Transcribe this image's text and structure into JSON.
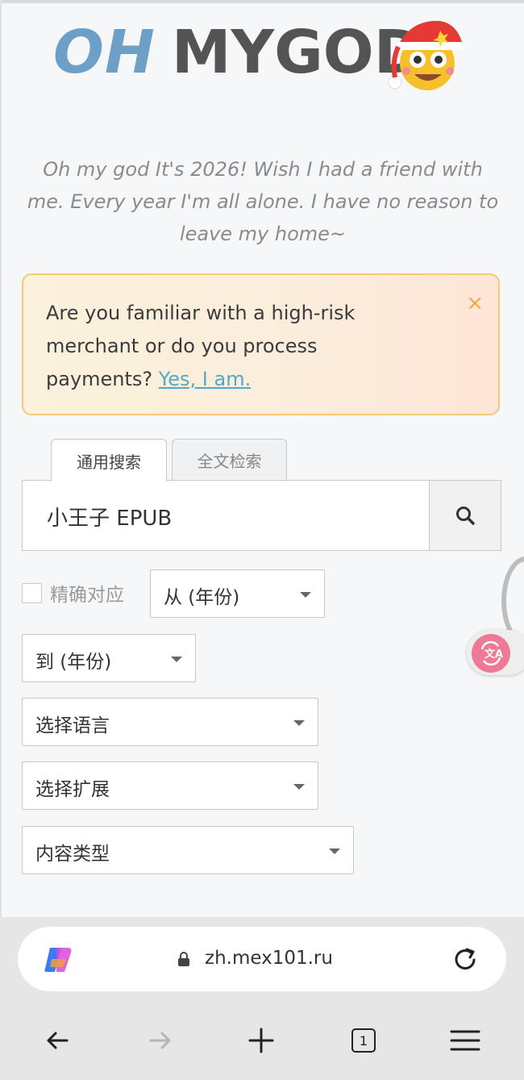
{
  "logo": {
    "part1": "OH",
    "part2": "MYGOD"
  },
  "tagline": "Oh my god It's 2026! Wish I had a friend with me. Every year I'm all alone. I have no reason to leave my home~",
  "alert": {
    "text": "Are you familiar with a high-risk merchant or do you process payments?",
    "link": "Yes, I am.",
    "close": "×"
  },
  "tabs": [
    {
      "label": "通用搜索",
      "active": true
    },
    {
      "label": "全文检索",
      "active": false
    }
  ],
  "search": {
    "value": "小王子 EPUB"
  },
  "filters": {
    "exact_match_label": "精确对应",
    "year_from": "从 (年份)",
    "year_to": "到 (年份)",
    "language": "选择语言",
    "extension": "选择扩展",
    "content_type": "内容类型"
  },
  "browser": {
    "url": "zh.mex101.ru",
    "tab_count": "1"
  },
  "colors": {
    "logo_oh": "#6e9fc6",
    "logo_god": "#545454",
    "alert_border": "#f4c97a",
    "link": "#56a6c8",
    "translate_accent": "#ee7a96"
  },
  "icons": [
    "emoji-santa-face-icon",
    "close-icon",
    "search-icon",
    "translate-icon",
    "copilot-icon",
    "lock-icon",
    "reload-icon",
    "back-icon",
    "forward-icon",
    "new-tab-icon",
    "tab-count-icon",
    "menu-icon"
  ]
}
